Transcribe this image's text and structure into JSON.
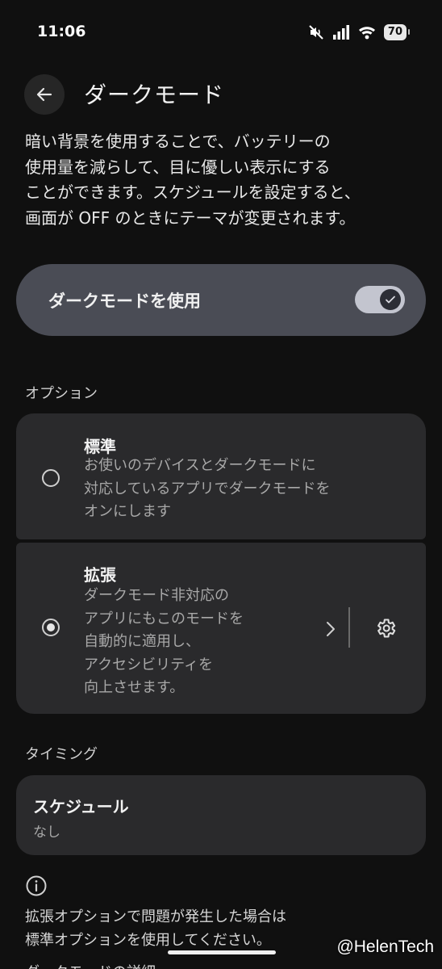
{
  "status_bar": {
    "time": "11:06",
    "battery": "70"
  },
  "header": {
    "title": "ダークモード"
  },
  "description": [
    "暗い背景を使用することで、バッテリーの",
    "使用量を減らして、目に優しい表示にする",
    "ことができます。スケジュールを設定すると、",
    "画面が OFF のときにテーマが変更されます。"
  ],
  "toggle": {
    "label": "ダークモードを使用",
    "enabled": true
  },
  "options_section": {
    "label": "オプション"
  },
  "options": [
    {
      "title": "標準",
      "desc": [
        "お使いのデバイスとダークモードに",
        "対応しているアプリでダークモードを",
        "オンにします"
      ],
      "selected": false
    },
    {
      "title": "拡張",
      "desc": [
        "ダークモード非対応の",
        "アプリにもこのモードを",
        "自動的に適用し、",
        "アクセシビリティを",
        "向上させます。"
      ],
      "selected": true
    }
  ],
  "timing_section": {
    "label": "タイミング"
  },
  "schedule": {
    "title": "スケジュール",
    "value": "なし"
  },
  "note": [
    "拡張オプションで問題が発生した場合は",
    "標準オプションを使用してください。"
  ],
  "cutoff_text": "ダークモードの詳細",
  "watermark": "@HelenTech",
  "colors": {
    "background": "#101010",
    "toggle_card": "#4a4c55",
    "card": "#2a2a2c"
  }
}
